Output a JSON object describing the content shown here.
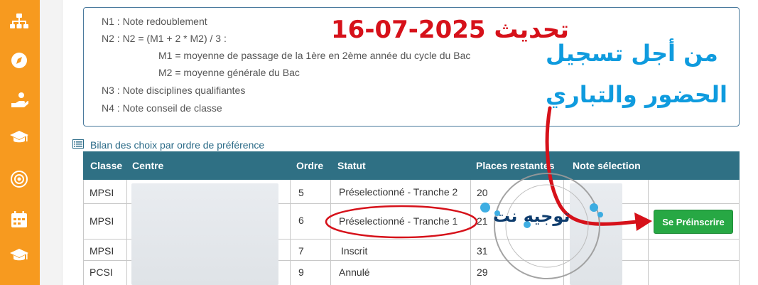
{
  "sidebar": {
    "icons": [
      "org-chart-icon",
      "compass-icon",
      "hand-money-icon",
      "graduation-cap-icon",
      "target-icon",
      "calendar-icon",
      "graduation-cap-icon"
    ]
  },
  "info": {
    "n1": "N1 : Note redoublement",
    "n2": "N2 : N2 = (M1 + 2 * M2) / 3 :",
    "m1": "M1 = moyenne de passage de la 1ère en 2ème année du cycle du Bac",
    "m2": "M2 = moyenne générale du Bac",
    "n3": "N3 : Note disciplines qualifiantes",
    "n4": "N4 : Note conseil de classe"
  },
  "overlay_text": {
    "update_title": "تحديث 2025-07-16",
    "note_line1": "من أجل تسجيل",
    "note_line2": "الحضور والتباري",
    "watermark": "توجيه نت"
  },
  "section": {
    "title": "Bilan des choix par ordre de préférence"
  },
  "table": {
    "headers": [
      "Classe",
      "Centre",
      "Ordre",
      "Statut",
      "Places restantes",
      "Note sélection"
    ],
    "rows": [
      {
        "classe": "MPSI",
        "ordre": "5",
        "statut": "Préselectionné - Tranche 2",
        "places": "20"
      },
      {
        "classe": "MPSI",
        "ordre": "6",
        "statut": "Préselectionné - Tranche 1",
        "places": "21"
      },
      {
        "classe": "MPSI",
        "ordre": "7",
        "statut": "Inscrit",
        "places": "31"
      },
      {
        "classe": "PCSI",
        "ordre": "9",
        "statut": "Annulé",
        "places": "29"
      }
    ],
    "action_button": "Se Préinscrire"
  },
  "colors": {
    "sidebar": "#f79a1f",
    "header": "#2f7084",
    "update_red": "#d6111a",
    "arabic_blue": "#0f9bde",
    "button_green": "#27a844",
    "highlight_red": "#d6111a"
  }
}
